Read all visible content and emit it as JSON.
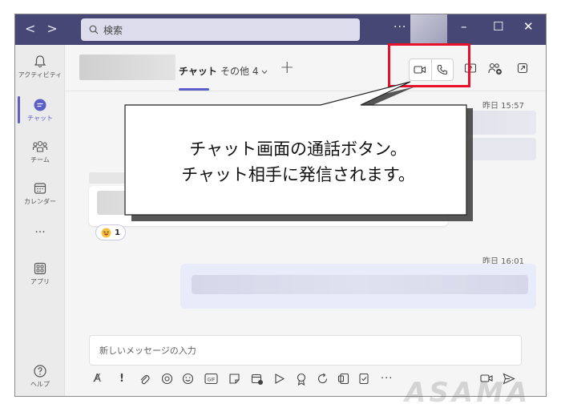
{
  "titlebar": {
    "back": "<",
    "forward": ">",
    "search_placeholder": "検索",
    "more": "···",
    "minimize": "–",
    "maximize": "☐",
    "close": "✕"
  },
  "rail": {
    "items": [
      {
        "label": "アクティビティ",
        "icon": "bell-icon"
      },
      {
        "label": "チャット",
        "icon": "chat-icon",
        "active": true
      },
      {
        "label": "チーム",
        "icon": "teams-icon"
      },
      {
        "label": "カレンダー",
        "icon": "calendar-icon"
      },
      {
        "label": "···",
        "icon": "more-icon"
      },
      {
        "label": "アプリ",
        "icon": "apps-icon"
      },
      {
        "label": "ヘルプ",
        "icon": "help-icon"
      }
    ]
  },
  "header": {
    "tab_chat": "チャット",
    "tab_other": "その他 4",
    "tab_add": "+"
  },
  "chat": {
    "time1": "昨日 15:57",
    "reaction_count": "1",
    "time2": "昨日 16:01"
  },
  "compose": {
    "placeholder": "新しいメッセージの入力"
  },
  "callout": {
    "line1": "チャット画面の通話ボタン。",
    "line2": "チャット相手に発信されます。"
  },
  "watermark": "ASAMA",
  "colors": {
    "titlebar": "#464775",
    "accent": "#5b5fc7",
    "highlight_box": "#e8102a"
  }
}
